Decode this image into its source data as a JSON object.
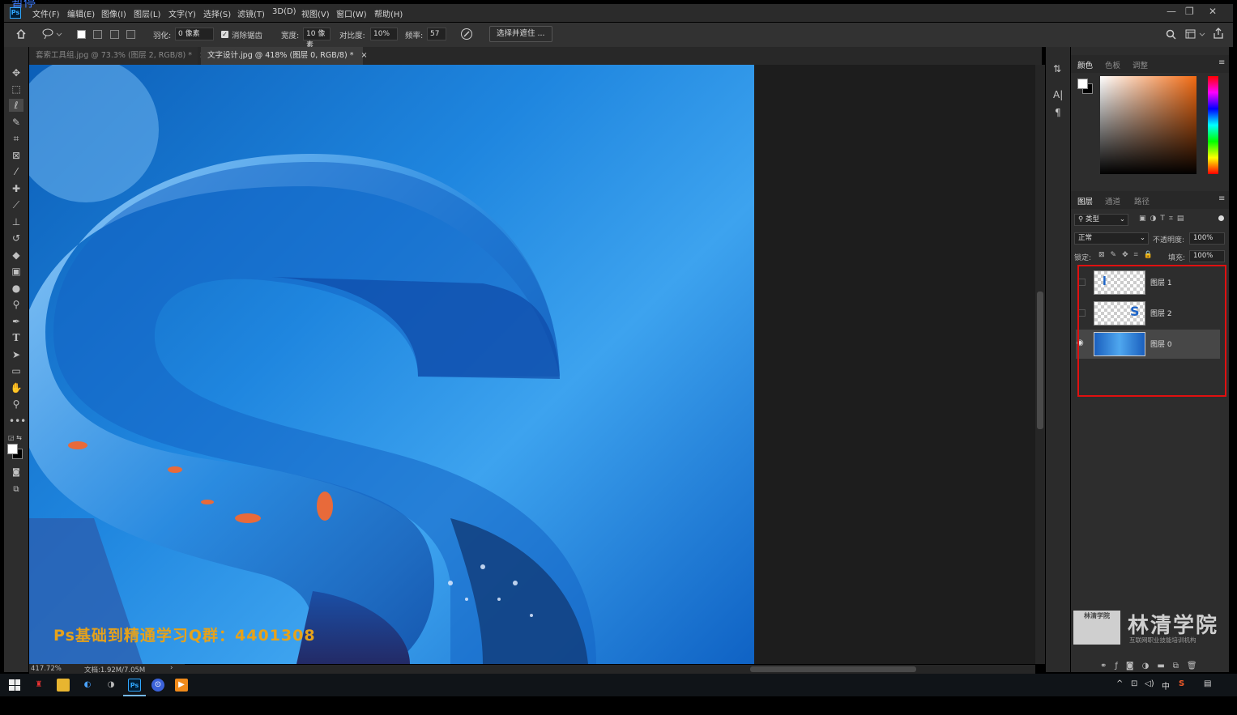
{
  "overlay_label": "暂停",
  "menu": {
    "app_icon": "Ps",
    "items": [
      "文件(F)",
      "编辑(E)",
      "图像(I)",
      "图层(L)",
      "文字(Y)",
      "选择(S)",
      "滤镜(T)",
      "3D(D)",
      "视图(V)",
      "窗口(W)",
      "帮助(H)"
    ],
    "window_controls": [
      "—",
      "❐",
      "✕"
    ]
  },
  "options": {
    "feather_label": "羽化:",
    "feather_value": "0 像素",
    "antialias_label": "消除锯齿",
    "antialias_checked": true,
    "width_label": "宽度:",
    "width_value": "10 像素",
    "contrast_label": "对比度:",
    "contrast_value": "10%",
    "frequency_label": "频率:",
    "frequency_value": "57",
    "select_mask_button": "选择并遮住 ..."
  },
  "tabs": [
    {
      "label": "套索工具组.jpg @ 73.3% (图层 2, RGB/8) *",
      "close": "×",
      "active": false
    },
    {
      "label": "文字设计.jpg @ 418% (图层 0, RGB/8) *",
      "close": "×",
      "active": true
    }
  ],
  "tools": [
    "move-icon",
    "marquee-icon",
    "magnetic-lasso-icon",
    "quick-select-icon",
    "crop-icon",
    "frame-icon",
    "eyedropper-icon",
    "healing-icon",
    "brush-icon",
    "stamp-icon",
    "history-brush-icon",
    "eraser-icon",
    "gradient-icon",
    "blur-icon",
    "dodge-icon",
    "pen-icon",
    "type-icon",
    "path-select-icon",
    "rectangle-icon",
    "hand-icon",
    "zoom-icon",
    "more-icon"
  ],
  "canvas": {
    "watermark": "Ps基础到精通学习Q群：4401308"
  },
  "status": {
    "zoom": "417.72%",
    "doc": "文档:1.92M/7.05M"
  },
  "color_panel": {
    "tabs": [
      "颜色",
      "色板",
      "调整"
    ],
    "active_tab": "颜色",
    "foreground": "#ffffff",
    "background": "#000000",
    "hue_color": "#f26a12"
  },
  "layers_panel": {
    "tabs": [
      "图层",
      "通道",
      "路径"
    ],
    "active_tab": "图层",
    "filter_label": "类型",
    "blend_mode": "正常",
    "opacity_label": "不透明度:",
    "opacity_value": "100%",
    "lock_label": "锁定:",
    "fill_label": "填充:",
    "fill_value": "100%",
    "layers": [
      {
        "name": "图层 1",
        "visible": false,
        "selected": false
      },
      {
        "name": "图层 2",
        "visible": false,
        "selected": false
      },
      {
        "name": "图层 0",
        "visible": true,
        "selected": true
      }
    ],
    "highlight_color": "#e01010"
  },
  "logo": {
    "box_text": "林清学院",
    "title": "林清学院",
    "subtitle": "互联网职业技能培训机构"
  },
  "taskbar": {
    "apps": [
      "start-icon",
      "bookmark-icon",
      "folder-icon",
      "browser-icon",
      "browser2-icon",
      "photoshop-icon",
      "app-icon",
      "player-icon"
    ],
    "ps_label": "Ps",
    "ime": "中",
    "tray": [
      "^",
      "⊡",
      "◁)",
      "中",
      "S"
    ]
  }
}
